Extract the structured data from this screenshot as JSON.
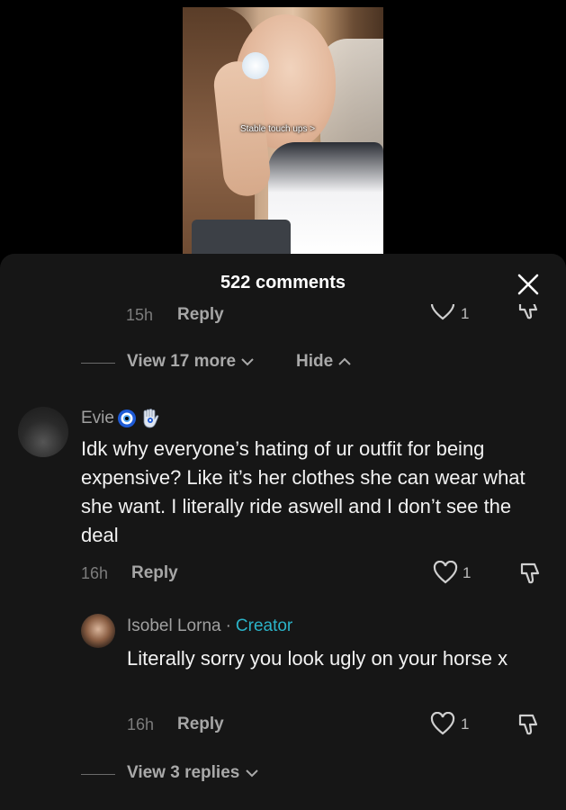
{
  "video": {
    "caption": "Stable touch ups >"
  },
  "comments_header": {
    "title": "522 comments"
  },
  "previous_comment": {
    "time": "15h",
    "reply_label": "Reply",
    "like_count": "1"
  },
  "thread_controls": {
    "view_more_label": "View 17 more",
    "hide_label": "Hide"
  },
  "comment": {
    "username": "Evie",
    "text": "Idk why everyone’s hating of ur outfit for being expensive? Like it’s her clothes she can wear what she want. I literally ride aswell and I don’t see the deal",
    "time": "16h",
    "reply_label": "Reply",
    "like_count": "1"
  },
  "reply": {
    "username": "Isobel Lorna",
    "separator": "·",
    "badge": "Creator",
    "text": "Literally sorry you look ugly on your horse x",
    "time": "16h",
    "reply_label": "Reply",
    "like_count": "1"
  },
  "replies_control": {
    "label": "View 3 replies"
  },
  "colors": {
    "sheet_bg": "#161616",
    "creator_accent": "#2bb3c8",
    "evil_eye_blue": "#1e5bd6"
  },
  "icons": [
    "close-icon",
    "heart-icon",
    "dislike-icon",
    "chevron-down-icon",
    "chevron-up-icon",
    "evil-eye-icon",
    "hamsa-icon"
  ]
}
